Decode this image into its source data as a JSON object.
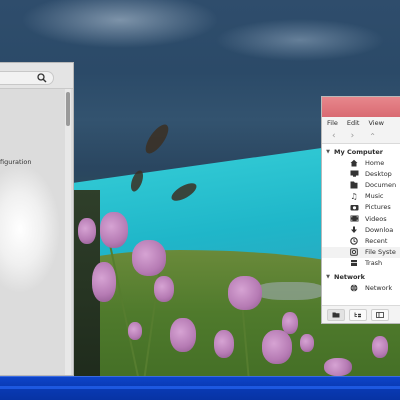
{
  "left_window": {
    "visible_text": "figuration"
  },
  "file_manager": {
    "menu": [
      "File",
      "Edit",
      "View"
    ],
    "sections": [
      {
        "title": "My Computer",
        "items": [
          {
            "label": "Home",
            "icon": "home-icon"
          },
          {
            "label": "Desktop",
            "icon": "desktop-icon"
          },
          {
            "label": "Documen",
            "icon": "documents-icon"
          },
          {
            "label": "Music",
            "icon": "music-icon"
          },
          {
            "label": "Pictures",
            "icon": "pictures-icon"
          },
          {
            "label": "Videos",
            "icon": "videos-icon"
          },
          {
            "label": "Downloa",
            "icon": "downloads-icon"
          },
          {
            "label": "Recent",
            "icon": "recent-icon"
          },
          {
            "label": "File Syste",
            "icon": "filesystem-icon"
          },
          {
            "label": "Trash",
            "icon": "trash-icon"
          }
        ]
      },
      {
        "title": "Network",
        "items": [
          {
            "label": "Network",
            "icon": "network-icon"
          }
        ]
      }
    ],
    "titlebar_color": "#dc7077"
  },
  "taskbar": {
    "color": "#0a3bb6"
  }
}
